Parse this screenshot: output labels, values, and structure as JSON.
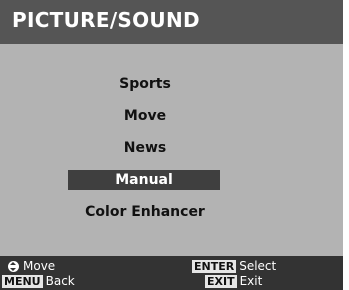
{
  "title": "PICTURE/SOUND",
  "menu": {
    "items": [
      {
        "label": "Sports",
        "selected": false
      },
      {
        "label": "Move",
        "selected": false
      },
      {
        "label": "News",
        "selected": false
      },
      {
        "label": "Manual",
        "selected": true
      },
      {
        "label": "Color Enhancer",
        "selected": false
      }
    ]
  },
  "footer": {
    "move_icon": "up-down-arrow-icon",
    "move_label": "Move",
    "menu_key": "MENU",
    "menu_label": "Back",
    "enter_key": "ENTER",
    "enter_label": "Select",
    "exit_key": "EXIT",
    "exit_label": "Exit"
  },
  "colors": {
    "title_bar": "#555555",
    "panel": "#b3b3b3",
    "selection": "#3f3f3f",
    "footer": "#333333"
  }
}
